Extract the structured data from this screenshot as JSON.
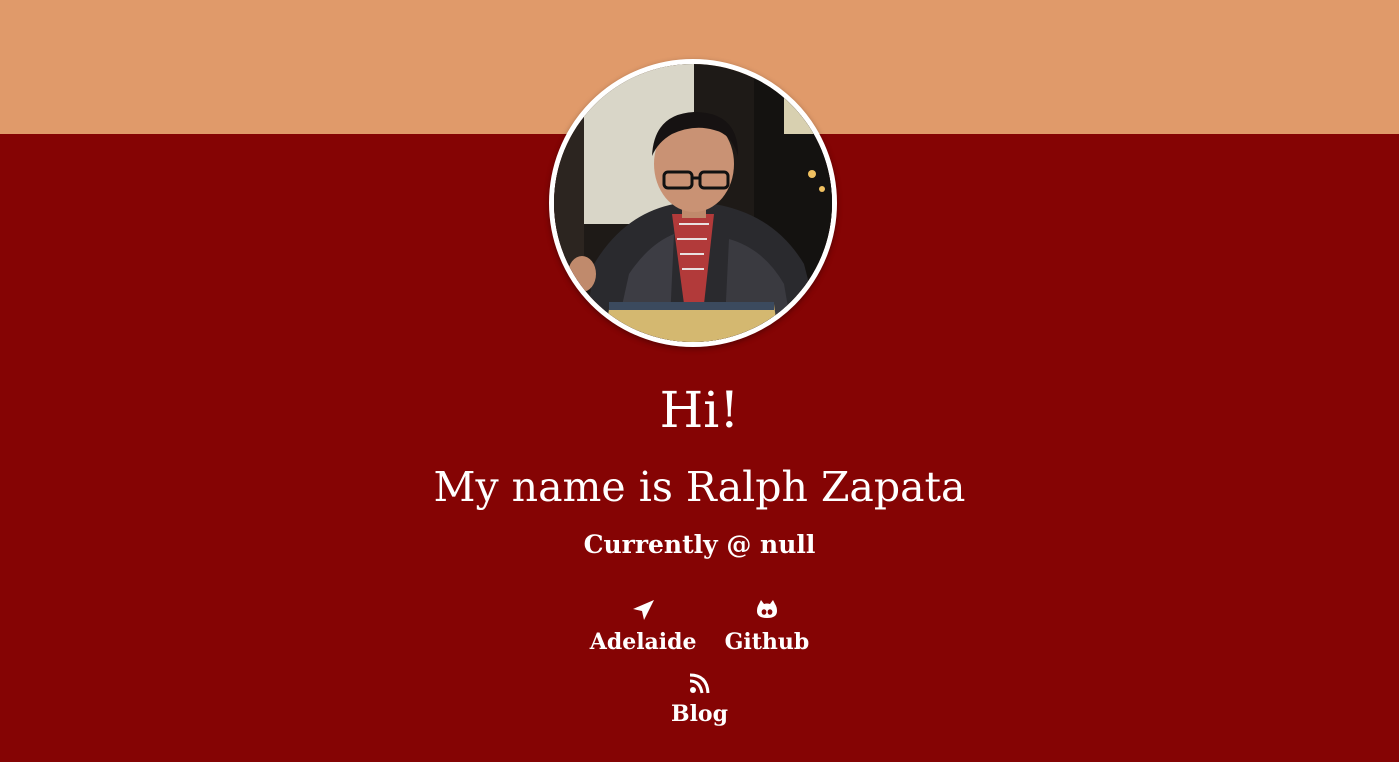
{
  "theme": {
    "background": "#850404",
    "top_band": "#e09a6a",
    "text": "#ffffff"
  },
  "avatar": {
    "alt": "Profile photo of Ralph Zapata"
  },
  "intro": {
    "greeting": "Hi!",
    "name_line": "My name is Ralph Zapata",
    "status": "Currently @ null"
  },
  "links": {
    "location": {
      "label": "Adelaide",
      "icon": "location-arrow-icon"
    },
    "github": {
      "label": "Github",
      "icon": "github-icon"
    },
    "blog": {
      "label": "Blog",
      "icon": "rss-icon"
    }
  }
}
